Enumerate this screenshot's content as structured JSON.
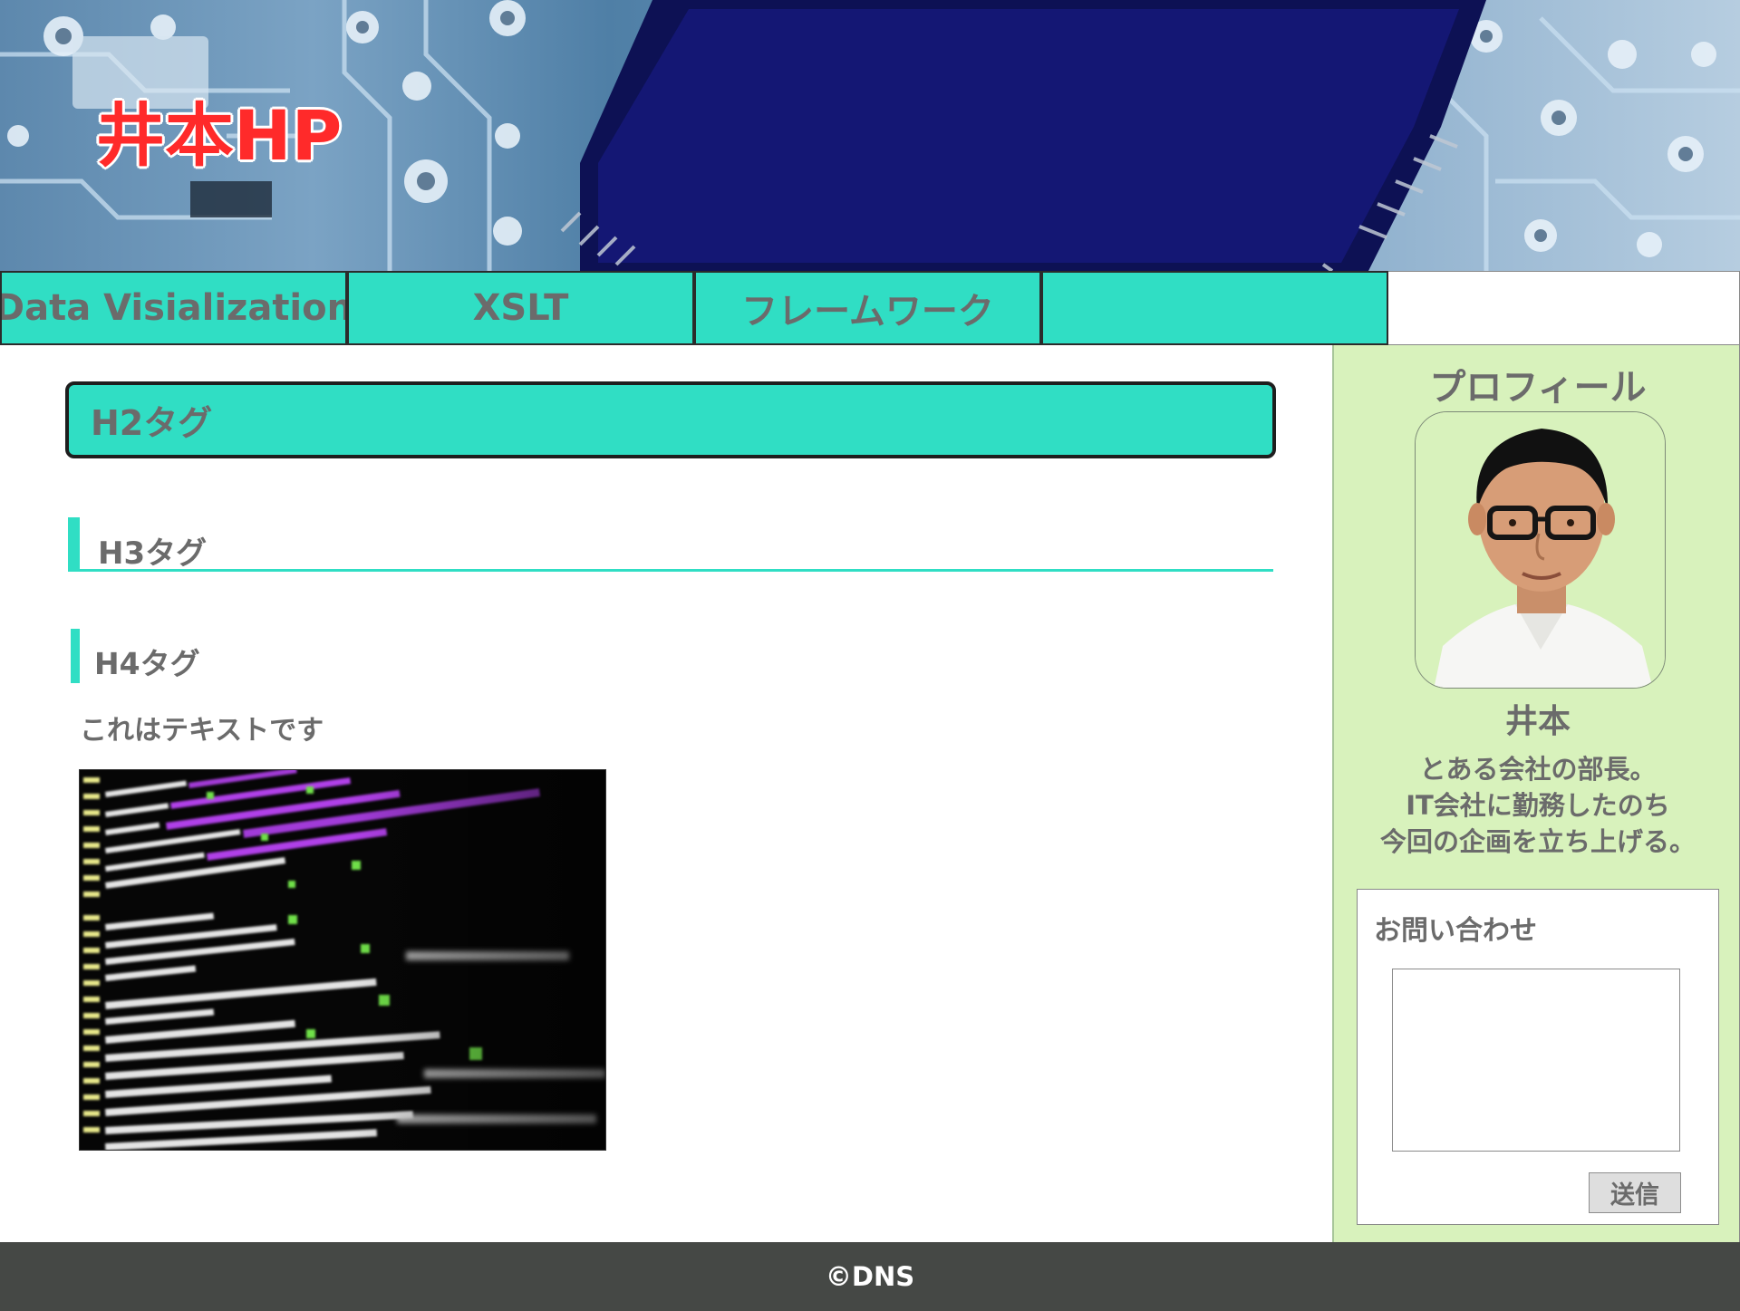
{
  "header": {
    "site_title": "井本HP"
  },
  "nav": {
    "items": [
      {
        "label": "Data Visialization"
      },
      {
        "label": "XSLT"
      },
      {
        "label": "フレームワーク"
      },
      {
        "label": ""
      }
    ]
  },
  "main": {
    "h2": "H2タグ",
    "h3": "H3タグ",
    "h4": "H4タグ",
    "paragraph": "これはテキストです"
  },
  "sidebar": {
    "title": "プロフィール",
    "name": "井本",
    "description_lines": [
      "とある会社の部長。",
      "IT会社に勤務したのち",
      "今回の企画を立ち上げる。"
    ],
    "contact": {
      "title": "お問い合わせ",
      "textarea_value": "",
      "send_label": "送信"
    }
  },
  "footer": {
    "copyright": "©DNS"
  },
  "colors": {
    "accent": "#30dec4",
    "sidebar_bg": "#d8f2bc",
    "footer_bg": "#454845",
    "title_red": "#ff2a2a",
    "text_gray": "#6b6b6b"
  }
}
